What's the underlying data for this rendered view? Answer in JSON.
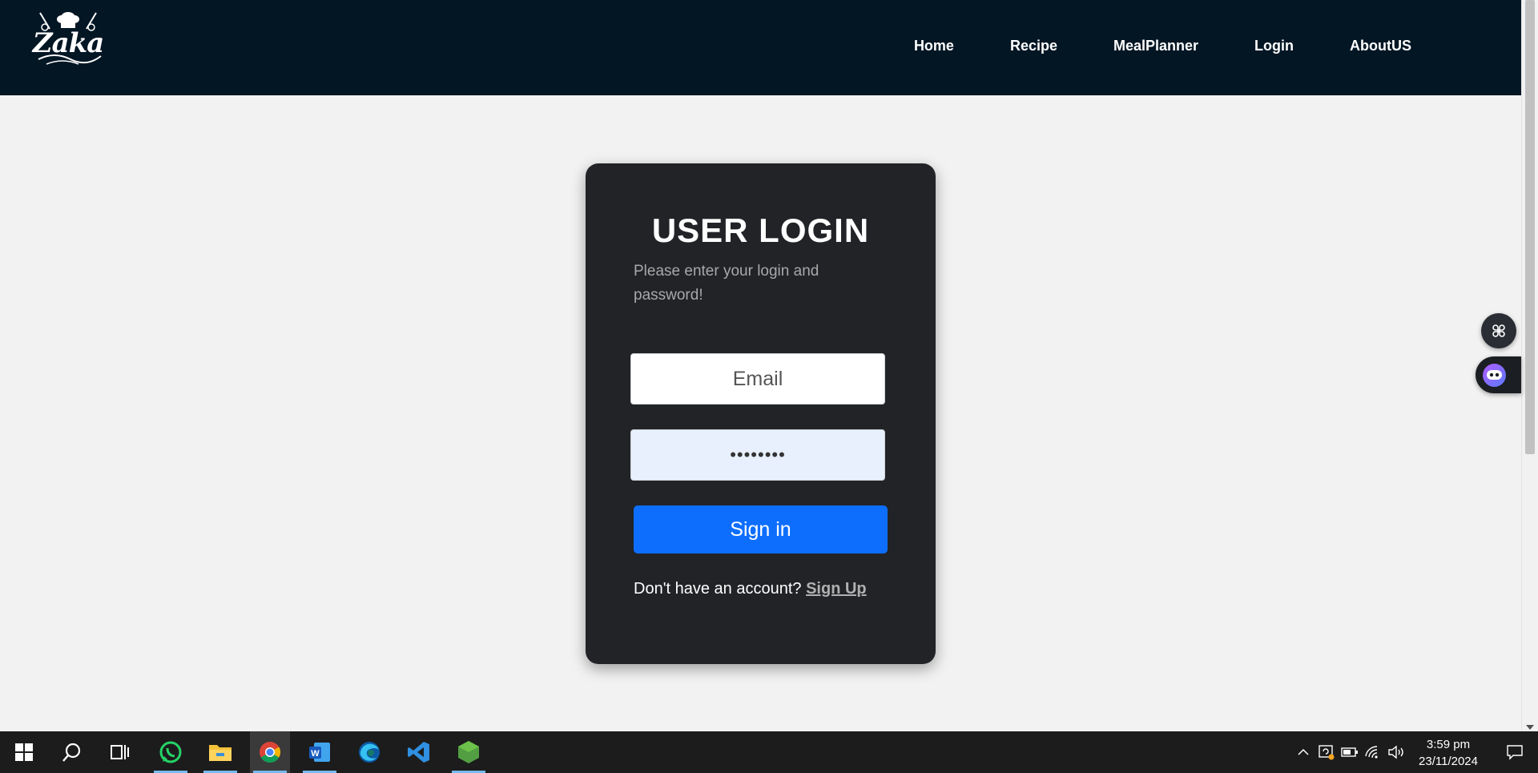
{
  "navbar": {
    "logo_text": "Zaka",
    "links": [
      {
        "label": "Home"
      },
      {
        "label": "Recipe"
      },
      {
        "label": "MealPlanner"
      },
      {
        "label": "Login"
      },
      {
        "label": "AboutUS"
      }
    ]
  },
  "login": {
    "title": "USER LOGIN",
    "subtitle": "Please enter your login and password!",
    "email_placeholder": "Email",
    "email_value": "",
    "password_value": "abcdefgh",
    "signin_label": "Sign in",
    "signup_prompt": "Don't have an account?",
    "signup_link": "Sign Up"
  },
  "colors": {
    "navbar_bg": "#031624",
    "page_bg": "#f2f2f2",
    "card_bg": "#212327",
    "primary_button": "#0d6efd",
    "password_field_bg": "#e8f0fe"
  },
  "taskbar": {
    "apps": [
      {
        "name": "start-icon"
      },
      {
        "name": "search-icon"
      },
      {
        "name": "task-view-icon"
      },
      {
        "name": "whatsapp-icon"
      },
      {
        "name": "file-explorer-icon"
      },
      {
        "name": "chrome-icon"
      },
      {
        "name": "word-icon"
      },
      {
        "name": "edge-icon"
      },
      {
        "name": "vscode-icon"
      },
      {
        "name": "nodejs-icon"
      }
    ],
    "tray_icons": [
      "chevron-up-icon",
      "security-icon",
      "battery-icon",
      "wifi-icon",
      "volume-icon"
    ],
    "time": "3:59 pm",
    "date": "23/11/2024"
  }
}
